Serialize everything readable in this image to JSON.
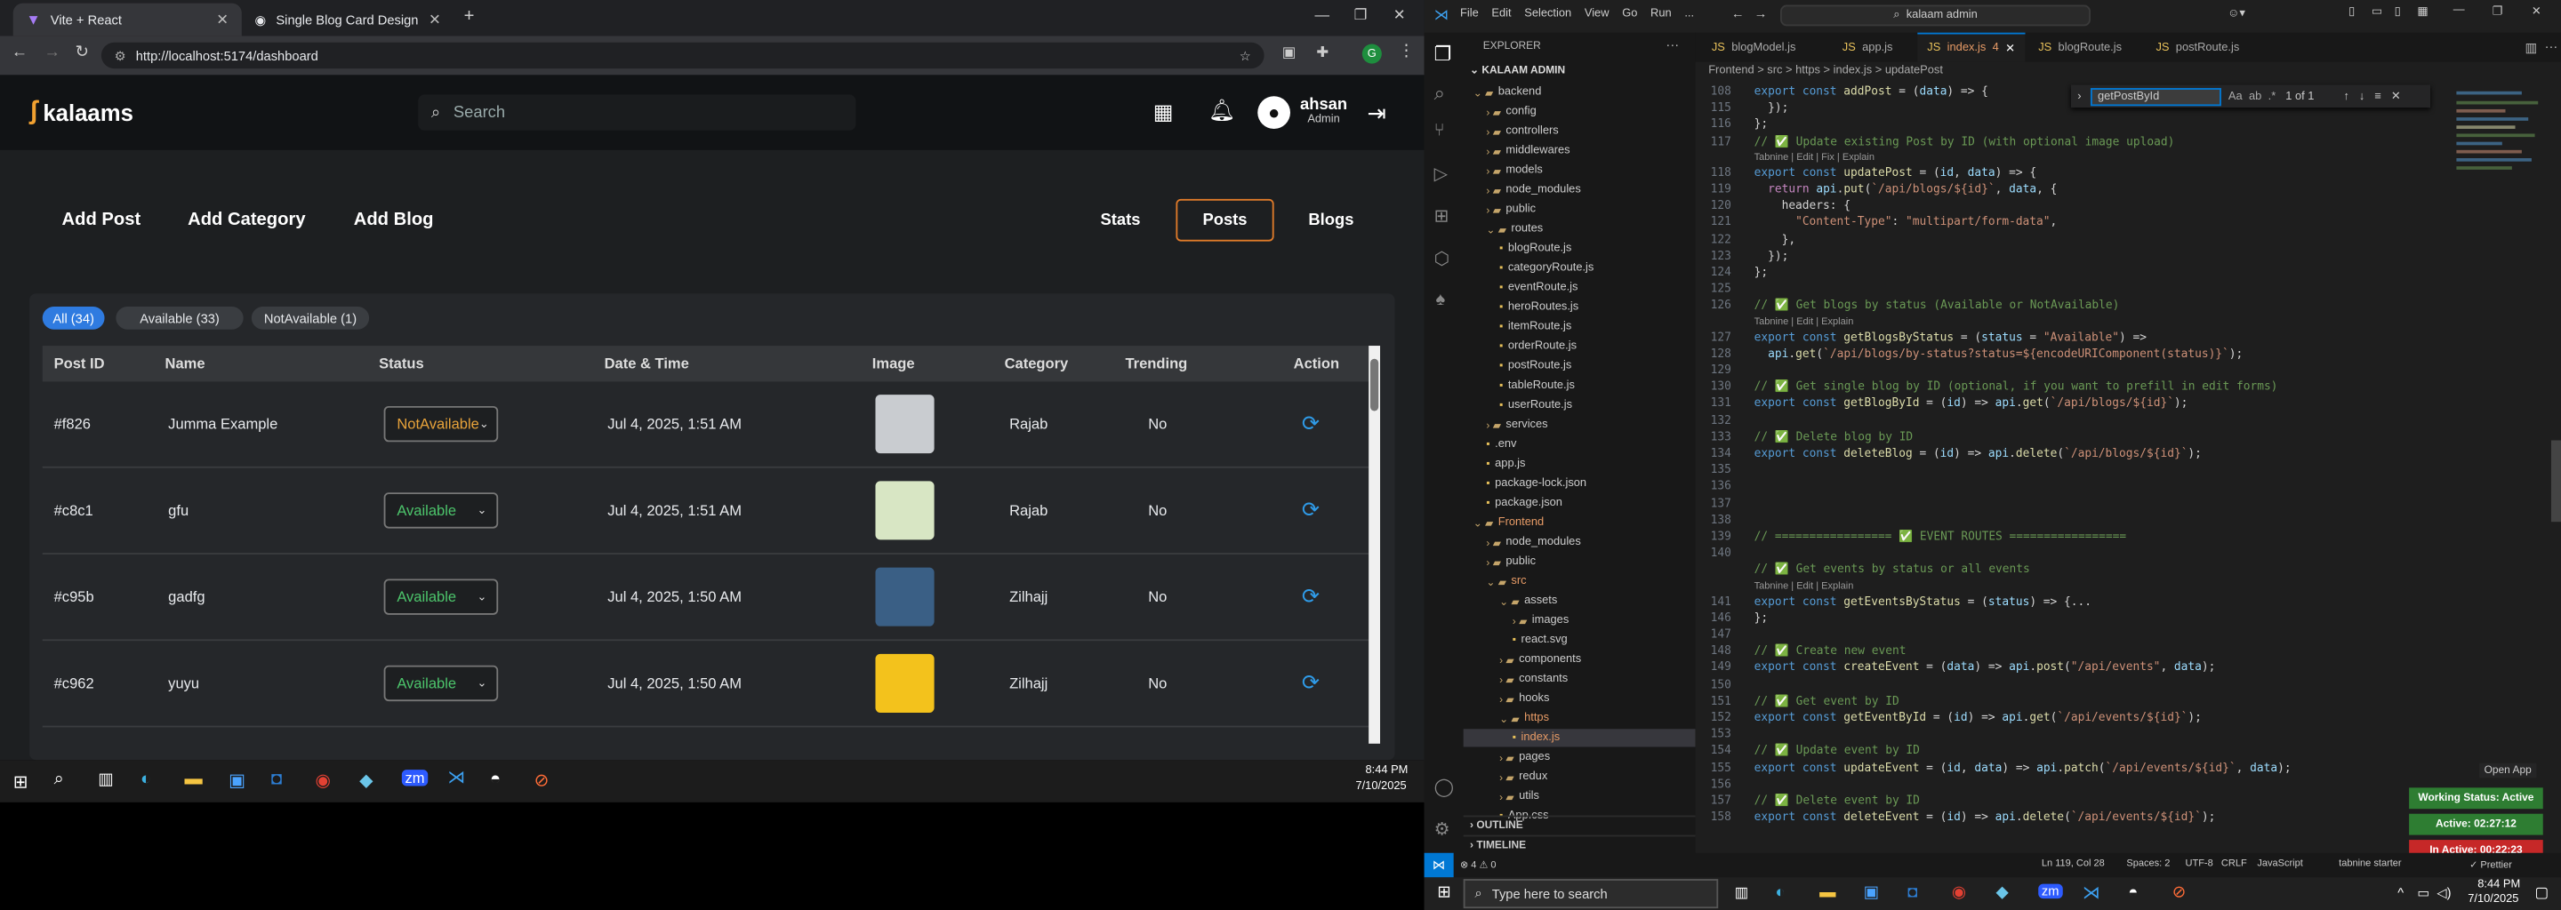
{
  "browser": {
    "tabs": [
      {
        "title": "Vite + React",
        "active": true
      },
      {
        "title": "Single Blog Card Design",
        "active": false
      }
    ],
    "url": "http://localhost:5174/dashboard"
  },
  "app": {
    "brand": "kalaams",
    "search_placeholder": "Search",
    "user": {
      "name": "ahsan",
      "role": "Admin"
    },
    "top_buttons": [
      "Add Post",
      "Add Category",
      "Add Blog"
    ],
    "section_buttons": [
      "Stats",
      "Posts",
      "Blogs"
    ],
    "active_section": "Posts",
    "filters": [
      "All (34)",
      "Available (33)",
      "NotAvailable (1)"
    ],
    "columns": [
      "Post ID",
      "Name",
      "Status",
      "Date & Time",
      "Image",
      "Category",
      "Trending",
      "Action"
    ],
    "rows": [
      {
        "id": "#f826",
        "name": "Jumma Example",
        "status": "NotAvailable",
        "date": "Jul 4, 2025, 1:51 AM",
        "category": "Rajab",
        "trending": "No",
        "status_color": "#e8a33a",
        "thumb_color": "#c9ccd0"
      },
      {
        "id": "#c8c1",
        "name": "gfu",
        "status": "Available",
        "date": "Jul 4, 2025, 1:51 AM",
        "category": "Rajab",
        "trending": "No",
        "status_color": "#4cc46b",
        "thumb_color": "#d8e6c4"
      },
      {
        "id": "#c95b",
        "name": "gadfg",
        "status": "Available",
        "date": "Jul 4, 2025, 1:50 AM",
        "category": "Zilhajj",
        "trending": "No",
        "status_color": "#4cc46b",
        "thumb_color": "#3a5f85"
      },
      {
        "id": "#c962",
        "name": "yuyu",
        "status": "Available",
        "date": "Jul 4, 2025, 1:50 AM",
        "category": "Zilhajj",
        "trending": "No",
        "status_color": "#4cc46b",
        "thumb_color": "#f3c21c"
      }
    ]
  },
  "taskbar_left": {
    "time": "8:44 PM",
    "date": "7/10/2025"
  },
  "vscode": {
    "menu": [
      "File",
      "Edit",
      "Selection",
      "View",
      "Go",
      "Run",
      "..."
    ],
    "command_center": "kalaam admin",
    "explorer_title": "EXPLORER",
    "workspace": "KALAAM ADMIN",
    "tree": [
      {
        "label": "backend",
        "type": "folder-open",
        "depth": 0
      },
      {
        "label": "config",
        "type": "folder",
        "depth": 1
      },
      {
        "label": "controllers",
        "type": "folder",
        "depth": 1
      },
      {
        "label": "middlewares",
        "type": "folder",
        "depth": 1
      },
      {
        "label": "models",
        "type": "folder",
        "depth": 1
      },
      {
        "label": "node_modules",
        "type": "folder",
        "depth": 1
      },
      {
        "label": "public",
        "type": "folder",
        "depth": 1
      },
      {
        "label": "routes",
        "type": "folder-open",
        "depth": 1
      },
      {
        "label": "blogRoute.js",
        "type": "file",
        "depth": 2
      },
      {
        "label": "categoryRoute.js",
        "type": "file",
        "depth": 2
      },
      {
        "label": "eventRoute.js",
        "type": "file",
        "depth": 2
      },
      {
        "label": "heroRoutes.js",
        "type": "file",
        "depth": 2
      },
      {
        "label": "itemRoute.js",
        "type": "file",
        "depth": 2
      },
      {
        "label": "orderRoute.js",
        "type": "file",
        "depth": 2
      },
      {
        "label": "postRoute.js",
        "type": "file",
        "depth": 2
      },
      {
        "label": "tableRoute.js",
        "type": "file",
        "depth": 2
      },
      {
        "label": "userRoute.js",
        "type": "file",
        "depth": 2
      },
      {
        "label": "services",
        "type": "folder",
        "depth": 1
      },
      {
        "label": ".env",
        "type": "file",
        "depth": 1
      },
      {
        "label": "app.js",
        "type": "file",
        "depth": 1
      },
      {
        "label": "package-lock.json",
        "type": "file",
        "depth": 1
      },
      {
        "label": "package.json",
        "type": "file",
        "depth": 1
      },
      {
        "label": "Frontend",
        "type": "folder-open",
        "depth": 0
      },
      {
        "label": "node_modules",
        "type": "folder",
        "depth": 1
      },
      {
        "label": "public",
        "type": "folder",
        "depth": 1
      },
      {
        "label": "src",
        "type": "folder-open",
        "depth": 1
      },
      {
        "label": "assets",
        "type": "folder-open",
        "depth": 2
      },
      {
        "label": "images",
        "type": "folder",
        "depth": 3
      },
      {
        "label": "react.svg",
        "type": "file",
        "depth": 3
      },
      {
        "label": "components",
        "type": "folder",
        "depth": 2
      },
      {
        "label": "constants",
        "type": "folder",
        "depth": 2
      },
      {
        "label": "hooks",
        "type": "folder",
        "depth": 2
      },
      {
        "label": "https",
        "type": "folder-open",
        "depth": 2
      },
      {
        "label": "index.js",
        "type": "file",
        "depth": 3
      },
      {
        "label": "pages",
        "type": "folder",
        "depth": 2
      },
      {
        "label": "redux",
        "type": "folder",
        "depth": 2
      },
      {
        "label": "utils",
        "type": "folder",
        "depth": 2
      },
      {
        "label": "App.css",
        "type": "file",
        "depth": 2
      }
    ],
    "outline": "OUTLINE",
    "timeline": "TIMELINE",
    "editor_tabs": [
      "blogModel.js",
      "app.js",
      "index.js",
      "blogRoute.js",
      "postRoute.js"
    ],
    "active_tab": "index.js",
    "active_tab_badge": "4",
    "breadcrumb": "Frontend > src > https > index.js > updatePost",
    "find": {
      "query": "getPostById",
      "result": "1 of 1"
    },
    "code_lines": [
      {
        "n": "108",
        "html": "<span class='kw'>export</span> <span class='kw'>const</span> <span class='fn'>addPost</span> = (<span class='vr'>data</span>) => {"
      },
      {
        "n": "115",
        "html": "  });"
      },
      {
        "n": "116",
        "html": "};"
      },
      {
        "n": "117",
        "html": "<span class='cm'>// ✅ Update existing Post by ID (with optional image upload)</span>"
      },
      {
        "lens": "Tabnine | Edit | Fix | Explain"
      },
      {
        "n": "118",
        "html": "<span class='kw'>export</span> <span class='kw'>const</span> <span class='fn'>updatePost</span> = (<span class='vr'>id</span>, <span class='vr'>data</span>) => {"
      },
      {
        "n": "119",
        "html": "  <span class='pn'>return</span> <span class='vr'>api</span>.<span class='fn'>put</span>(<span class='str'>`/api/blogs/${id}`</span>, <span class='vr'>data</span>, {"
      },
      {
        "n": "120",
        "html": "    headers: {"
      },
      {
        "n": "121",
        "html": "      <span class='str'>\"Content-Type\"</span>: <span class='str'>\"multipart/form-data\"</span>,"
      },
      {
        "n": "122",
        "html": "    },"
      },
      {
        "n": "123",
        "html": "  });"
      },
      {
        "n": "124",
        "html": "};"
      },
      {
        "n": "125",
        "html": ""
      },
      {
        "n": "126",
        "html": "<span class='cm'>// ✅ Get blogs by status (Available or NotAvailable)</span>"
      },
      {
        "lens": "Tabnine | Edit | Explain"
      },
      {
        "n": "127",
        "html": "<span class='kw'>export</span> <span class='kw'>const</span> <span class='fn'>getBlogsByStatus</span> = (<span class='vr'>status</span> = <span class='str'>\"Available\"</span>) =>"
      },
      {
        "n": "128",
        "html": "  <span class='vr'>api</span>.<span class='fn'>get</span>(<span class='str'>`/api/blogs/by-status?status=${encodeURIComponent(status)}`</span>);"
      },
      {
        "n": "129",
        "html": ""
      },
      {
        "n": "130",
        "html": "<span class='cm'>// ✅ Get single blog by ID (optional, if you want to prefill in edit forms)</span>"
      },
      {
        "n": "131",
        "html": "<span class='kw'>export</span> <span class='kw'>const</span> <span class='fn'>getBlogById</span> = (<span class='vr'>id</span>) => <span class='vr'>api</span>.<span class='fn'>get</span>(<span class='str'>`/api/blogs/${id}`</span>);"
      },
      {
        "n": "132",
        "html": ""
      },
      {
        "n": "133",
        "html": "<span class='cm'>// ✅ Delete blog by ID</span>"
      },
      {
        "n": "134",
        "html": "<span class='kw'>export</span> <span class='kw'>const</span> <span class='fn'>deleteBlog</span> = (<span class='vr'>id</span>) => <span class='vr'>api</span>.<span class='fn'>delete</span>(<span class='str'>`/api/blogs/${id}`</span>);"
      },
      {
        "n": "135",
        "html": ""
      },
      {
        "n": "136",
        "html": ""
      },
      {
        "n": "137",
        "html": ""
      },
      {
        "n": "138",
        "html": ""
      },
      {
        "n": "139",
        "html": "<span class='cm'>// ================= ✅ EVENT ROUTES =================</span>"
      },
      {
        "n": "140",
        "html": ""
      },
      {
        "n": "",
        "html": "<span class='cm'>// ✅ Get events by status or all events</span>"
      },
      {
        "lens": "Tabnine | Edit | Explain"
      },
      {
        "n": "141",
        "html": "<span class='kw'>export</span> <span class='kw'>const</span> <span class='fn'>getEventsByStatus</span> = (<span class='vr'>status</span>) => {<span class='ln2'>...</span>"
      },
      {
        "n": "146",
        "html": "};"
      },
      {
        "n": "147",
        "html": ""
      },
      {
        "n": "148",
        "html": "<span class='cm'>// ✅ Create new event</span>"
      },
      {
        "n": "149",
        "html": "<span class='kw'>export</span> <span class='kw'>const</span> <span class='fn'>createEvent</span> = (<span class='vr'>data</span>) => <span class='vr'>api</span>.<span class='fn'>post</span>(<span class='str'>\"/api/events\"</span>, <span class='vr'>data</span>);"
      },
      {
        "n": "150",
        "html": ""
      },
      {
        "n": "151",
        "html": "<span class='cm'>// ✅ Get event by ID</span>"
      },
      {
        "n": "152",
        "html": "<span class='kw'>export</span> <span class='kw'>const</span> <span class='fn'>getEventById</span> = (<span class='vr'>id</span>) => <span class='vr'>api</span>.<span class='fn'>get</span>(<span class='str'>`/api/events/${id}`</span>);"
      },
      {
        "n": "153",
        "html": ""
      },
      {
        "n": "154",
        "html": "<span class='cm'>// ✅ Update event by ID</span>"
      },
      {
        "n": "155",
        "html": "<span class='kw'>export</span> <span class='kw'>const</span> <span class='fn'>updateEvent</span> = (<span class='vr'>id</span>, <span class='vr'>data</span>) => <span class='vr'>api</span>.<span class='fn'>patch</span>(<span class='str'>`/api/events/${id}`</span>, <span class='vr'>data</span>);"
      },
      {
        "n": "156",
        "html": ""
      },
      {
        "n": "157",
        "html": "<span class='cm'>// ✅ Delete event by ID</span>"
      },
      {
        "n": "158",
        "html": "<span class='kw'>export</span> <span class='kw'>const</span> <span class='fn'>deleteEvent</span> = (<span class='vr'>id</span>) => <span class='vr'>api</span>.<span class='fn'>delete</span>(<span class='str'>`/api/events/${id}`</span>);"
      }
    ],
    "status": {
      "problems": "⊗ 4 ⚠ 0",
      "position": "Ln 119, Col 28",
      "spaces": "Spaces: 2",
      "encoding": "UTF-8",
      "eol": "CRLF",
      "language": "JavaScript",
      "tabnine": "tabnine starter",
      "prettier": "✓ Prettier"
    },
    "open_app": "Open App",
    "working_status": "Working Status: Active",
    "active_time": "Active: 02:27:12",
    "inactive_time": "In Active: 00:22:23"
  },
  "taskbar_main": {
    "search_placeholder": "Type here to search",
    "time": "8:44 PM",
    "date": "7/10/2025"
  },
  "colors": {
    "accent": "#2f7be0",
    "posts_border": "#e07b2a",
    "vscode_blue": "#0078d4"
  }
}
